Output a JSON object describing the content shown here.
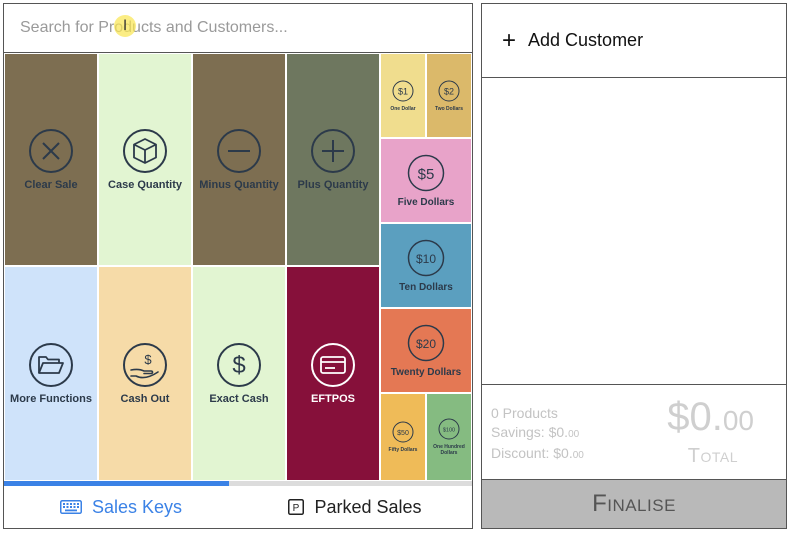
{
  "search": {
    "placeholder": "Search for Products and Customers..."
  },
  "keys": {
    "clear_sale": "Clear Sale",
    "case_quantity": "Case Quantity",
    "minus_quantity": "Minus Quantity",
    "plus_quantity": "Plus Quantity",
    "more_functions": "More Functions",
    "cash_out": "Cash Out",
    "exact_cash": "Exact Cash",
    "eftpos": "EFTPOS"
  },
  "denominations": {
    "one_dollar": {
      "symbol": "$1",
      "label": "One Dollar"
    },
    "two_dollars": {
      "symbol": "$2",
      "label": "Two Dollars"
    },
    "five_dollars": {
      "symbol": "$5",
      "label": "Five Dollars"
    },
    "ten_dollars": {
      "symbol": "$10",
      "label": "Ten Dollars"
    },
    "twenty_dollars": {
      "symbol": "$20",
      "label": "Twenty Dollars"
    },
    "fifty_dollars": {
      "symbol": "$50",
      "label": "Fifty Dollars"
    },
    "hundred_dollars": {
      "symbol": "$100",
      "label": "One Hundred Dollars"
    }
  },
  "colors": {
    "olive": "#7d6e51",
    "sage": "#6e775f",
    "pale_green": "#e2f5d2",
    "pale_blue": "#cfe3fa",
    "peach": "#f6dba8",
    "maroon": "#86103a",
    "coin_yellow": "#f0dd8e",
    "coin_tan": "#dbb96a",
    "pink": "#e8a3c9",
    "steel_blue": "#5b9fbf",
    "coral": "#e47854",
    "amber": "#efbb58",
    "green": "#85bb81",
    "accent_blue": "#3b82e6"
  },
  "tabs": {
    "sales_keys": "Sales Keys",
    "parked_sales": "Parked Sales"
  },
  "progress": {
    "sales_keys_fraction": 0.48
  },
  "customer": {
    "add_label": "Add Customer"
  },
  "summary": {
    "products": "0 Products",
    "savings_label": "Savings: $0.",
    "savings_cents": "00",
    "discount_label": "Discount: $0.",
    "discount_cents": "00",
    "total_dollars": "$0.",
    "total_cents": "00",
    "total_label": "Total"
  },
  "finalise": {
    "label": "Finalise"
  }
}
